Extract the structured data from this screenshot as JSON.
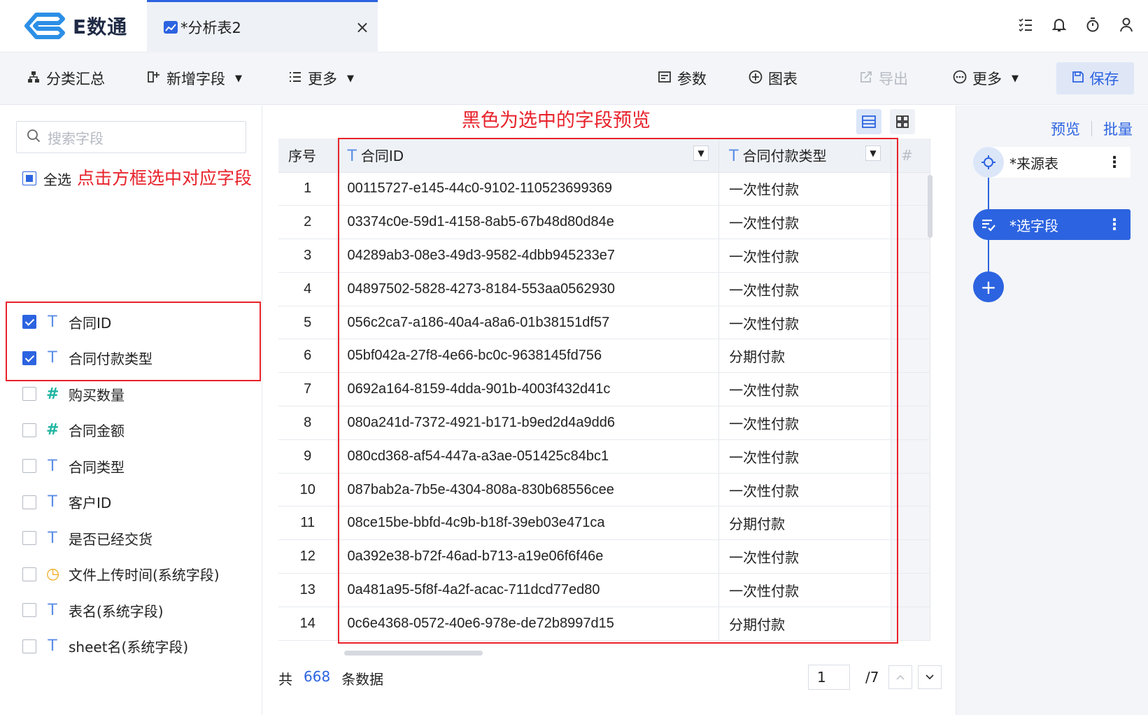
{
  "app": {
    "brand": "E数通"
  },
  "tab": {
    "title": "*分析表2",
    "close": "×"
  },
  "top_icons": [
    "list-check-icon",
    "bell-icon",
    "timer-icon",
    "user-icon"
  ],
  "toolbar": {
    "group_summary": "分类汇总",
    "add_field": "新增字段",
    "more_left": "更多",
    "params": "参数",
    "chart": "图表",
    "export": "导出",
    "more_right": "更多",
    "save": "保存"
  },
  "left_panel": {
    "search_placeholder": "搜索字段",
    "select_all": "全选",
    "annotation": "点击方框选中对应字段",
    "fields": [
      {
        "label": "合同ID",
        "type": "text",
        "checked": true
      },
      {
        "label": "合同付款类型",
        "type": "text",
        "checked": true
      },
      {
        "label": "购买数量",
        "type": "number",
        "checked": false
      },
      {
        "label": "合同金额",
        "type": "number",
        "checked": false
      },
      {
        "label": "合同类型",
        "type": "text",
        "checked": false
      },
      {
        "label": "客户ID",
        "type": "text",
        "checked": false
      },
      {
        "label": "是否已经交货",
        "type": "text",
        "checked": false
      },
      {
        "label": "文件上传时间(系统字段)",
        "type": "time",
        "checked": false
      },
      {
        "label": "表名(系统字段)",
        "type": "text",
        "checked": false
      },
      {
        "label": "sheet名(系统字段)",
        "type": "text",
        "checked": false
      }
    ]
  },
  "main": {
    "annotation": "黑色为选中的字段预览",
    "columns": [
      "序号",
      "合同ID",
      "合同付款类型",
      "#"
    ],
    "rows": [
      [
        "1",
        "00115727-e145-44c0-9102-110523699369",
        "一次性付款"
      ],
      [
        "2",
        "03374c0e-59d1-4158-8ab5-67b48d80d84e",
        "一次性付款"
      ],
      [
        "3",
        "04289ab3-08e3-49d3-9582-4dbb945233e7",
        "一次性付款"
      ],
      [
        "4",
        "04897502-5828-4273-8184-553aa0562930",
        "一次性付款"
      ],
      [
        "5",
        "056c2ca7-a186-40a4-a8a6-01b38151df57",
        "一次性付款"
      ],
      [
        "6",
        "05bf042a-27f8-4e66-bc0c-9638145fd756",
        "分期付款"
      ],
      [
        "7",
        "0692a164-8159-4dda-901b-4003f432d41c",
        "一次性付款"
      ],
      [
        "8",
        "080a241d-7372-4921-b171-b9ed2d4a9dd6",
        "一次性付款"
      ],
      [
        "9",
        "080cd368-af54-447a-a3ae-051425c84bc1",
        "一次性付款"
      ],
      [
        "10",
        "087bab2a-7b5e-4304-808a-830b68556cee",
        "一次性付款"
      ],
      [
        "11",
        "08ce15be-bbfd-4c9b-b18f-39eb03e471ca",
        "分期付款"
      ],
      [
        "12",
        "0a392e38-b72f-46ad-b713-a19e06f6f46e",
        "一次性付款"
      ],
      [
        "13",
        "0a481a95-5f8f-4a2f-acac-711dcd77ed80",
        "一次性付款"
      ],
      [
        "14",
        "0c6e4368-0572-40e6-978e-de72b8997d15",
        "分期付款"
      ]
    ],
    "footer": {
      "prefix": "共",
      "total": "668",
      "suffix": "条数据"
    },
    "pager": {
      "current": "1",
      "total": "/7"
    }
  },
  "right_panel": {
    "preview": "预览",
    "batch": "批量",
    "nodes": [
      {
        "label": "*来源表",
        "icon": "target-icon"
      },
      {
        "label": "*选字段",
        "icon": "field-select-icon"
      }
    ],
    "add": "+"
  },
  "colors": {
    "accent": "#2c63e0",
    "annotation_red": "#e8222b"
  }
}
